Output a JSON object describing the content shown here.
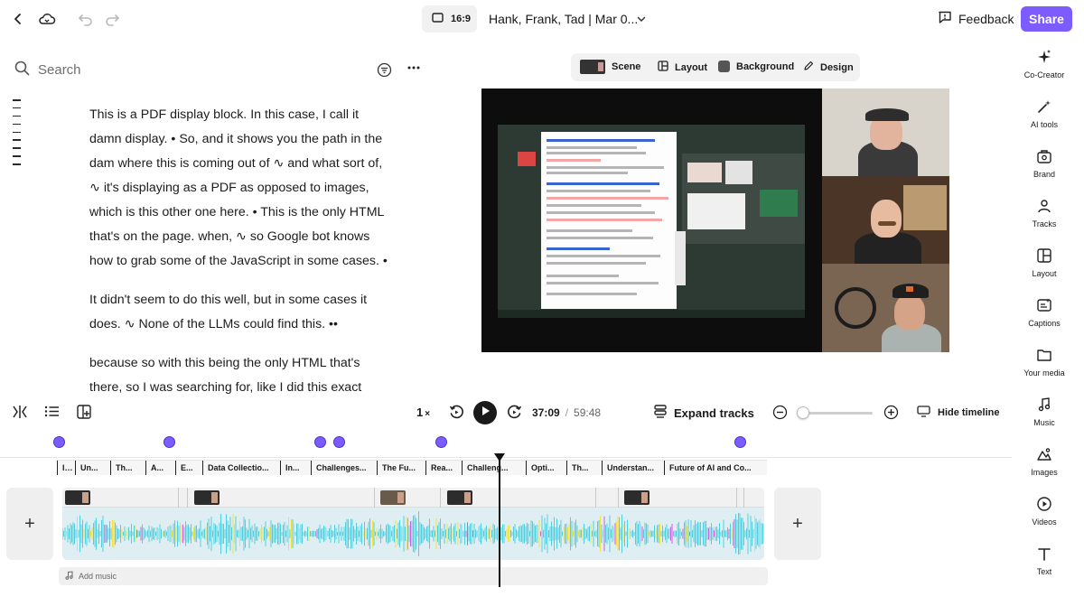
{
  "topbar": {
    "aspect_ratio": "16:9",
    "project_title": "Hank, Frank, Tad | Mar 0...",
    "feedback_label": "Feedback",
    "share_label": "Share"
  },
  "transcript_panel": {
    "search_placeholder": "Search",
    "paragraphs": [
      "This is a PDF display block. In this case, I call it damn display. • So, and it shows you the path in the dam where this is coming out of ∿ and what sort of, ∿ it's displaying as a PDF as opposed to images, which is this other one here. • This is the only HTML that's on the page. when, ∿ so Google bot knows how to grab some of the JavaScript in some cases. •",
      "It didn't seem to do this well, but in some cases it does. ∿ None of the LLMs could find this. ••",
      "because so with this being the only HTML that's there, so I was searching for, like I did this exact"
    ]
  },
  "scene_toolbar": {
    "scene_label": "Scene",
    "layout_label": "Layout",
    "background_label": "Background",
    "design_label": "Design"
  },
  "right_rail": {
    "items": [
      {
        "label": "Co-Creator",
        "icon": "sparkle-icon"
      },
      {
        "label": "AI tools",
        "icon": "magic-wand-icon"
      },
      {
        "label": "Brand",
        "icon": "brand-kit-icon"
      },
      {
        "label": "Tracks",
        "icon": "people-icon"
      },
      {
        "label": "Layout",
        "icon": "layout-grid-icon"
      },
      {
        "label": "Captions",
        "icon": "captions-icon"
      },
      {
        "label": "Your media",
        "icon": "folder-icon"
      },
      {
        "label": "Music",
        "icon": "music-note-icon"
      },
      {
        "label": "Images",
        "icon": "image-icon"
      },
      {
        "label": "Videos",
        "icon": "play-circle-icon"
      },
      {
        "label": "Text",
        "icon": "text-icon"
      }
    ]
  },
  "playback": {
    "speed": "1",
    "current_time": "37:09",
    "separator": "/",
    "total_time": "59:48",
    "expand_tracks_label": "Expand tracks",
    "hide_timeline_label": "Hide timeline",
    "zoom_level_fraction": 0.0
  },
  "timeline": {
    "chapters": [
      "I...",
      "Un...",
      "Th...",
      "A...",
      "E...",
      "Data Collectio...",
      "In...",
      "Challenges...",
      "The Fu...",
      "Rea...",
      "Challeng...",
      "Opti...",
      "Th...",
      "Understan...",
      "Future of AI and Co..."
    ],
    "add_music_label": "Add music",
    "colors": {
      "accent": "#7c5cff",
      "waveform_primary": "#4fd0e0",
      "waveform_secondary": "#f0e23a",
      "waveform_tertiary": "#d35ce0"
    }
  }
}
